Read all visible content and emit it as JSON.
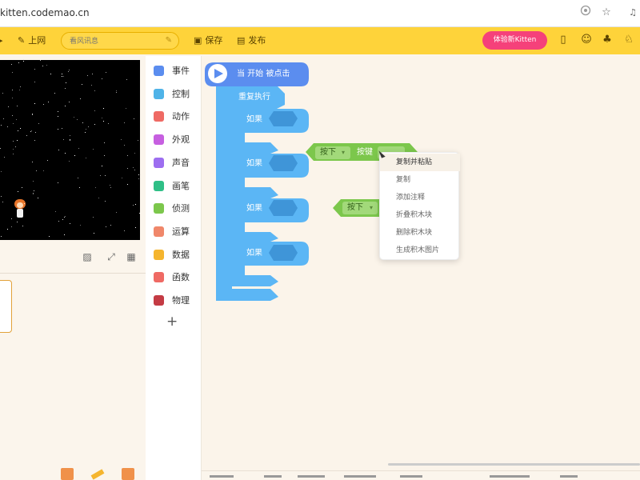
{
  "browser": {
    "url": "kitten.codemao.cn"
  },
  "toolbar": {
    "online_label": "上网",
    "title_placeholder": "看风讯息",
    "save_label": "保存",
    "publish_label": "发布",
    "try_label": "体验新Kitten"
  },
  "categories": [
    {
      "label": "事件",
      "color": "#5b8def"
    },
    {
      "label": "控制",
      "color": "#4fb3e8"
    },
    {
      "label": "动作",
      "color": "#ef6a64"
    },
    {
      "label": "外观",
      "color": "#c65fe0"
    },
    {
      "label": "声音",
      "color": "#9d6ef0"
    },
    {
      "label": "画笔",
      "color": "#2fbf86"
    },
    {
      "label": "侦测",
      "color": "#7cc74c"
    },
    {
      "label": "运算",
      "color": "#f0876a"
    },
    {
      "label": "数据",
      "color": "#f5b52e"
    },
    {
      "label": "函数",
      "color": "#ef6a64"
    },
    {
      "label": "物理",
      "color": "#c43b44"
    }
  ],
  "blocks": {
    "start_label": "当 开始 被点击",
    "repeat_label": "重复执行",
    "if_label": "如果",
    "key_press_label": "按下",
    "key_label": "按键"
  },
  "context_menu": {
    "items": [
      "复制并粘贴",
      "复制",
      "添加注释",
      "折叠积木块",
      "删除积木块",
      "生成积木图片"
    ]
  }
}
